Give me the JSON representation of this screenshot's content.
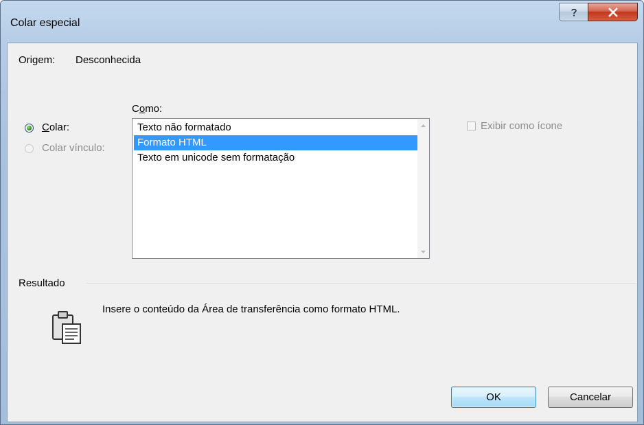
{
  "window": {
    "title": "Colar especial"
  },
  "source": {
    "label": "Origem:",
    "value": "Desconhecida"
  },
  "como": {
    "label_pre": "C",
    "label_ul": "o",
    "label_post": "mo:"
  },
  "paste_options": {
    "paste": {
      "label_ul": "C",
      "label_rest": "olar:",
      "selected": true
    },
    "paste_link": {
      "label": "Colar vínculo:",
      "enabled": false
    }
  },
  "formats": {
    "items": [
      "Texto não formatado",
      "Formato HTML",
      "Texto em unicode sem formatação"
    ],
    "selected_index": 1
  },
  "display_as_icon": {
    "label": "Exibir como ícone",
    "checked": false,
    "enabled": false
  },
  "result": {
    "heading": "Resultado",
    "description": "Insere o conteúdo da Área de transferência como formato HTML.",
    "icon": "clipboard-icon"
  },
  "buttons": {
    "ok": "OK",
    "cancel": "Cancelar"
  },
  "colors": {
    "selection": "#3399ff",
    "title_bar": "#b6cde6",
    "close_button": "#c2361e"
  }
}
